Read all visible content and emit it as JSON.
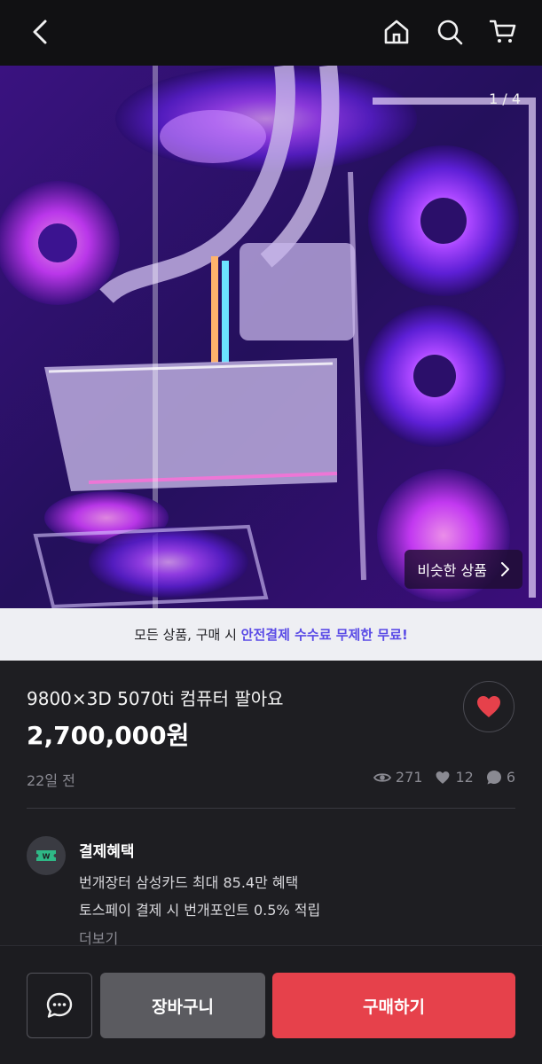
{
  "header": {
    "back_icon": "chevron-left-icon",
    "home_icon": "home-icon",
    "search_icon": "search-icon",
    "cart_icon": "cart-icon"
  },
  "gallery": {
    "counter": "1 / 4",
    "similar_label": "비슷한 상품"
  },
  "notice": {
    "prefix": "모든 상품, 구매 시 ",
    "highlight": "안전결제 수수료 무제한 무료!"
  },
  "product": {
    "title": "9800×3D 5070ti 컴퓨터 팔아요",
    "price": "2,700,000원",
    "posted": "22일 전",
    "views": "271",
    "likes": "12",
    "chats": "6"
  },
  "benefit": {
    "title": "결제혜택",
    "icon_text": "W",
    "lines": [
      "번개장터 삼성카드 최대 85.4만 혜택",
      "토스페이 결제 시 번개포인트 0.5% 적립"
    ],
    "more": "더보기"
  },
  "actions": {
    "chat_icon": "chat-icon",
    "cart_label": "장바구니",
    "buy_label": "구매하기"
  },
  "colors": {
    "accent": "#5a4be6",
    "buy": "#e6414b",
    "heart": "#e6414b",
    "benefit_icon": "#2fb886"
  }
}
